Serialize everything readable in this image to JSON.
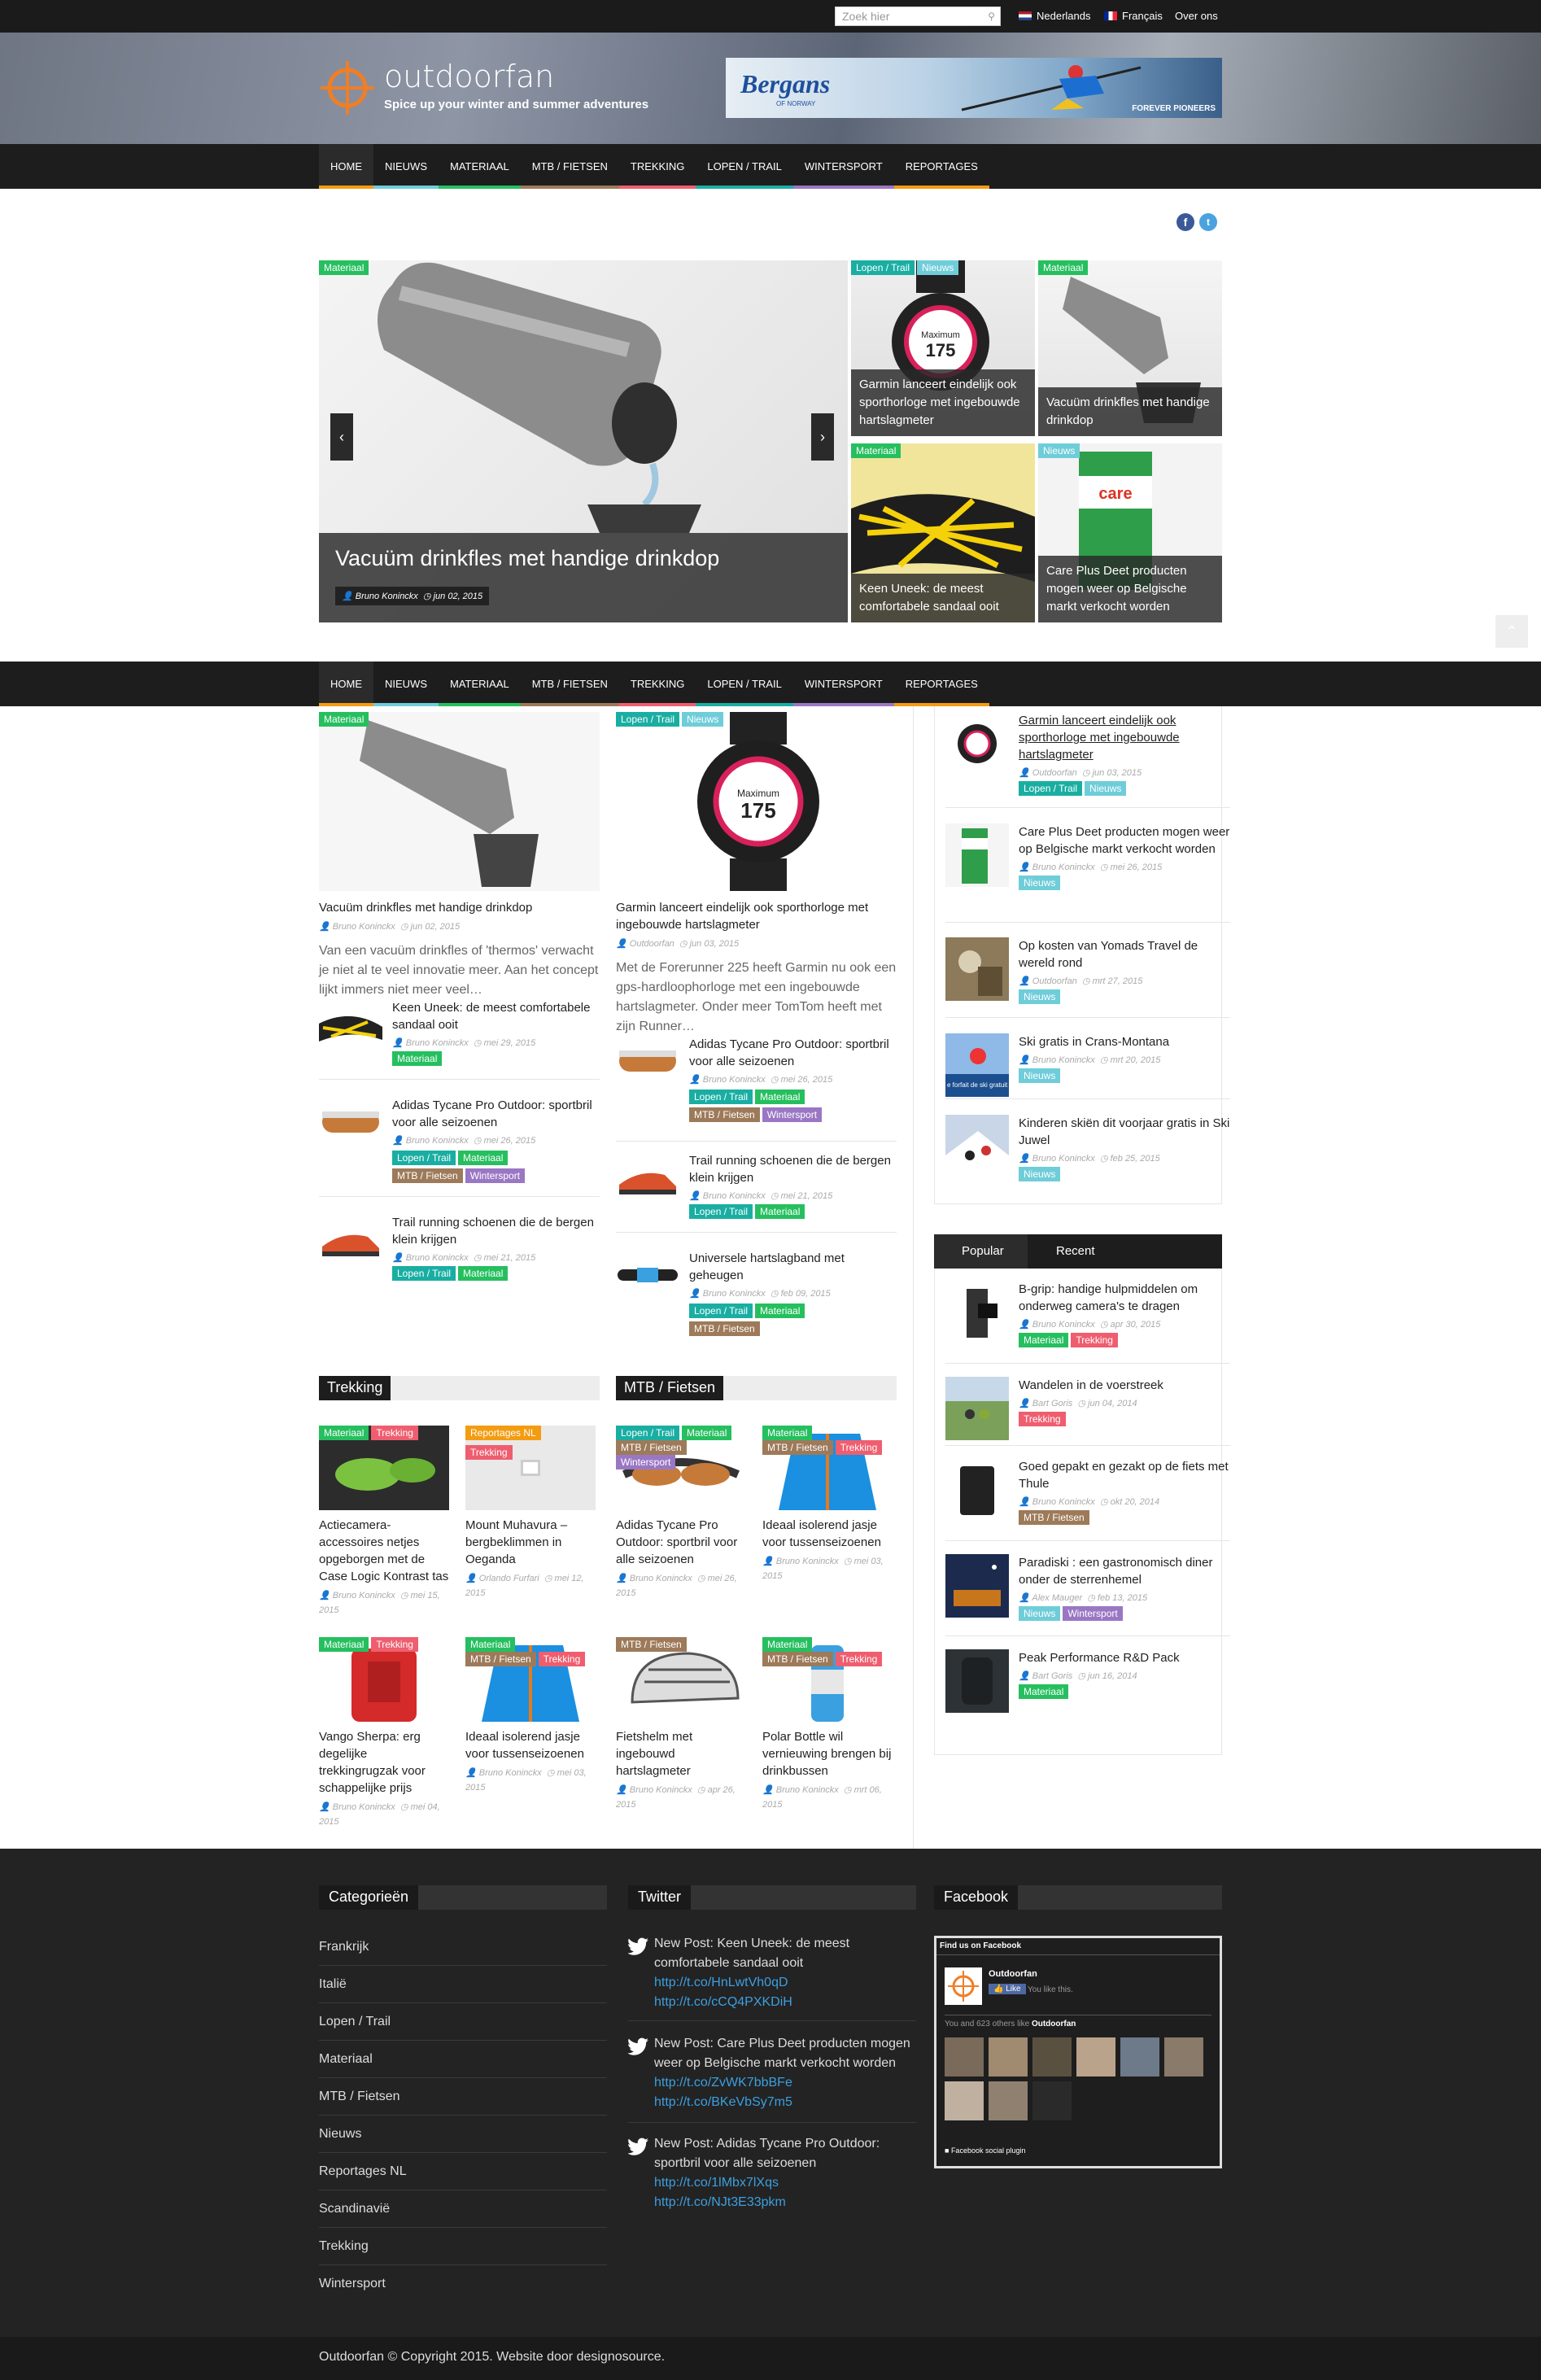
{
  "topbar": {
    "search_placeholder": "Zoek hier",
    "lang_nl": "Nederlands",
    "lang_fr": "Français",
    "about": "Over ons"
  },
  "header": {
    "site_title": "outdoorfan",
    "tagline": "Spice up your winter and summer adventures",
    "banner_brand": "Bergans",
    "banner_brand_sub": "OF NORWAY",
    "banner_tagline": "FOREVER PIONEERS"
  },
  "nav": [
    {
      "label": "Home",
      "color": "#f39c12"
    },
    {
      "label": "Nieuws",
      "color": "#6fcdd9"
    },
    {
      "label": "Materiaal",
      "color": "#26bf5f"
    },
    {
      "label": "MTB / Fietsen",
      "color": "#9d7a5a"
    },
    {
      "label": "Trekking",
      "color": "#ef5e6f"
    },
    {
      "label": "Lopen / Trail",
      "color": "#1aaea3"
    },
    {
      "label": "Wintersport",
      "color": "#9a77c4"
    },
    {
      "label": "Reportages",
      "color": "#f39c12"
    }
  ],
  "slider": {
    "main": {
      "tag": "Materiaal",
      "title": "Vacuüm drinkfles met handige drinkdop",
      "author": "Bruno Koninckx",
      "date": "jun 02, 2015"
    },
    "prev": "‹",
    "next": "›",
    "tiles": [
      {
        "tags": [
          "Lopen / Trail",
          "Nieuws"
        ],
        "title": "Garmin lanceert eindelijk ook sporthorloge met ingebouwde hartslagmeter"
      },
      {
        "tags": [
          "Materiaal"
        ],
        "title": "Vacuüm drinkfles met handige drinkdop"
      },
      {
        "tags": [
          "Materiaal"
        ],
        "title": "Keen Uneek: de meest comfortabele sandaal ooit"
      },
      {
        "tags": [
          "Nieuws"
        ],
        "title": "Care Plus Deet producten mogen weer op Belgische markt verkocht worden"
      }
    ]
  },
  "watch_display": {
    "label": "Maximum",
    "value": "175"
  },
  "col1": {
    "feature": {
      "tag": "Materiaal",
      "title": "Vacuüm drinkfles met handige drinkdop",
      "author": "Bruno Koninckx",
      "date": "jun 02, 2015",
      "excerpt": "Van een vacuüm drinkfles of 'thermos' verwacht je niet al te veel innovatie meer. Aan het concept lijkt immers niet meer veel…"
    },
    "items": [
      {
        "title": "Keen Uneek: de meest comfortabele sandaal ooit",
        "author": "Bruno Koninckx",
        "date": "mei 29, 2015",
        "tags": [
          "Materiaal"
        ]
      },
      {
        "title": "Adidas Tycane Pro Outdoor: sportbril voor alle seizoenen",
        "author": "Bruno Koninckx",
        "date": "mei 26, 2015",
        "tags": [
          "Lopen / Trail",
          "Materiaal",
          "MTB / Fietsen",
          "Wintersport"
        ]
      },
      {
        "title": "Trail running schoenen die de bergen klein krijgen",
        "author": "Bruno Koninckx",
        "date": "mei 21, 2015",
        "tags": [
          "Lopen / Trail",
          "Materiaal"
        ]
      }
    ]
  },
  "col2": {
    "feature": {
      "tags": [
        "Lopen / Trail",
        "Nieuws"
      ],
      "title": "Garmin lanceert eindelijk ook sporthorloge met ingebouwde hartslagmeter",
      "author": "Outdoorfan",
      "date": "jun 03, 2015",
      "excerpt": "Met de Forerunner 225 heeft Garmin nu ook een gps-hardloophorloge met een ingebouwde hartslagmeter. Onder meer TomTom heeft met zijn Runner…"
    },
    "items": [
      {
        "title": "Adidas Tycane Pro Outdoor: sportbril voor alle seizoenen",
        "author": "Bruno Koninckx",
        "date": "mei 26, 2015",
        "tags": [
          "Lopen / Trail",
          "Materiaal",
          "MTB / Fietsen",
          "Wintersport"
        ]
      },
      {
        "title": "Trail running schoenen die de bergen klein krijgen",
        "author": "Bruno Koninckx",
        "date": "mei 21, 2015",
        "tags": [
          "Lopen / Trail",
          "Materiaal"
        ]
      },
      {
        "title": "Universele hartslagband met geheugen",
        "author": "Bruno Koninckx",
        "date": "feb 09, 2015",
        "tags": [
          "Lopen / Trail",
          "Materiaal",
          "MTB / Fietsen"
        ]
      }
    ]
  },
  "trekking": {
    "title": "Trekking",
    "items": [
      {
        "tags": [
          "Materiaal",
          "Trekking"
        ],
        "title": "Actiecamera-accessoires netjes opgeborgen met de Case Logic Kontrast tas",
        "author": "Bruno Koninckx",
        "date": "mei 15, 2015"
      },
      {
        "tags": [
          "Reportages NL",
          "Trekking"
        ],
        "title": "Mount Muhavura – bergbeklimmen in Oeganda",
        "author": "Orlando Furfari",
        "date": "mei 12, 2015"
      },
      {
        "tags": [
          "Materiaal",
          "Trekking"
        ],
        "title": "Vango Sherpa: erg degelijke trekkingrugzak voor schappelijke prijs",
        "author": "Bruno Koninckx",
        "date": "mei 04, 2015"
      },
      {
        "tags": [
          "Materiaal",
          "MTB / Fietsen",
          "Trekking"
        ],
        "title": "Ideaal isolerend jasje voor tussenseizoenen",
        "author": "Bruno Koninckx",
        "date": "mei 03, 2015"
      }
    ]
  },
  "mtb": {
    "title": "MTB / Fietsen",
    "items": [
      {
        "tags": [
          "Lopen / Trail",
          "Materiaal",
          "MTB / Fietsen",
          "Wintersport"
        ],
        "title": "Adidas Tycane Pro Outdoor: sportbril voor alle seizoenen",
        "author": "Bruno Koninckx",
        "date": "mei 26, 2015"
      },
      {
        "tags": [
          "Materiaal",
          "MTB / Fietsen",
          "Trekking"
        ],
        "title": "Ideaal isolerend jasje voor tussenseizoenen",
        "author": "Bruno Koninckx",
        "date": "mei 03, 2015"
      },
      {
        "tags": [
          "MTB / Fietsen"
        ],
        "title": "Fietshelm met ingebouwd hartslagmeter",
        "author": "Bruno Koninckx",
        "date": "apr 26, 2015"
      },
      {
        "tags": [
          "Materiaal",
          "MTB / Fietsen",
          "Trekking"
        ],
        "title": "Polar Bottle wil vernieuwing brengen bij drinkbussen",
        "author": "Bruno Koninckx",
        "date": "mrt 06, 2015"
      }
    ]
  },
  "sidebar_latest": [
    {
      "title": "Garmin lanceert eindelijk ook sporthorloge met ingebouwde hartslagmeter",
      "author": "Outdoorfan",
      "date": "jun 03, 2015",
      "tags": [
        "Lopen / Trail",
        "Nieuws"
      ]
    },
    {
      "title": "Care Plus Deet producten mogen weer op Belgische markt verkocht worden",
      "author": "Bruno Koninckx",
      "date": "mei 26, 2015",
      "tags": [
        "Nieuws"
      ]
    },
    {
      "title": "Op kosten van Yomads Travel de wereld rond",
      "author": "Outdoorfan",
      "date": "mrt 27, 2015",
      "tags": [
        "Nieuws"
      ]
    },
    {
      "title": "Ski gratis in Crans-Montana",
      "author": "Bruno Koninckx",
      "date": "mrt 20, 2015",
      "tags": [
        "Nieuws"
      ]
    },
    {
      "title": "Kinderen skiën dit voorjaar gratis in Ski Juwel",
      "author": "Bruno Koninckx",
      "date": "feb 25, 2015",
      "tags": [
        "Nieuws"
      ]
    }
  ],
  "sidebar_ski_caption": "e forfait de ski gratuit",
  "tabs": {
    "popular": "Popular",
    "recent": "Recent"
  },
  "sidebar_popular": [
    {
      "title": "B-grip: handige hulpmiddelen om onderweg camera's te dragen",
      "author": "Bruno Koninckx",
      "date": "apr 30, 2015",
      "tags": [
        "Materiaal",
        "Trekking"
      ]
    },
    {
      "title": "Wandelen in de voerstreek",
      "author": "Bart Goris",
      "date": "jun 04, 2014",
      "tags": [
        "Trekking"
      ]
    },
    {
      "title": "Goed gepakt en gezakt op de fiets met Thule",
      "author": "Bruno Koninckx",
      "date": "okt 20, 2014",
      "tags": [
        "MTB / Fietsen"
      ]
    },
    {
      "title": "Paradiski : een gastronomisch diner onder de sterrenhemel",
      "author": "Alex Mauger",
      "date": "feb 13, 2015",
      "tags": [
        "Nieuws",
        "Wintersport"
      ]
    },
    {
      "title": "Peak Performance R&D Pack",
      "author": "Bart Goris",
      "date": "jun 16, 2014",
      "tags": [
        "Materiaal"
      ]
    }
  ],
  "footer": {
    "categories_title": "Categorieën",
    "categories": [
      "Frankrijk",
      "Italië",
      "Lopen / Trail",
      "Materiaal",
      "MTB / Fietsen",
      "Nieuws",
      "Reportages NL",
      "Scandinavië",
      "Trekking",
      "Wintersport"
    ],
    "twitter_title": "Twitter",
    "tweets": [
      {
        "text": "New Post: Keen Uneek: de meest comfortabele sandaal ooit",
        "links": [
          "http://t.co/HnLwtVh0qD",
          "http://t.co/cCQ4PXKDiH"
        ]
      },
      {
        "text": "New Post: Care Plus Deet producten mogen weer op Belgische markt verkocht worden",
        "links": [
          "http://t.co/ZvWK7bbBFe",
          "http://t.co/BKeVbSy7m5"
        ]
      },
      {
        "text": "New Post: Adidas Tycane Pro Outdoor: sportbril voor alle seizoenen",
        "links": [
          "http://t.co/1lMbx7lXqs",
          "http://t.co/NJt3E33pkm"
        ]
      }
    ],
    "facebook_title": "Facebook",
    "fb_header": "Find us on Facebook",
    "fb_page": "Outdoorfan",
    "fb_like": "Like",
    "fb_like_text": "You like this.",
    "fb_others_prefix": "You and 623 others like",
    "fb_others_page": "Outdoorfan",
    "fb_plugin": "Facebook social plugin",
    "copyright": "Outdoorfan © Copyright 2015. Website door designosource."
  }
}
